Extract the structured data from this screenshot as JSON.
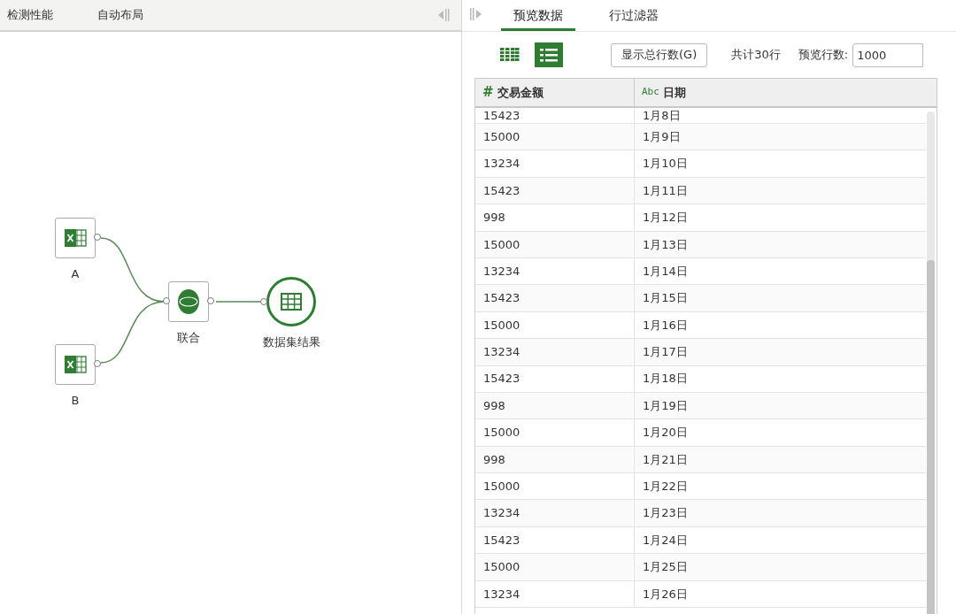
{
  "left_toolbar": {
    "items": [
      "检测性能",
      "自动布局"
    ]
  },
  "canvas": {
    "nodes": [
      {
        "kind": "excel",
        "label": "A"
      },
      {
        "kind": "excel",
        "label": "B"
      },
      {
        "kind": "union",
        "label": "联合"
      },
      {
        "kind": "output",
        "label": "数据集结果"
      }
    ]
  },
  "tabs": [
    {
      "label": "预览数据",
      "selected": true
    },
    {
      "label": "行过滤器",
      "selected": false
    }
  ],
  "view_modes": [
    {
      "kind": "grid",
      "selected": false
    },
    {
      "kind": "list",
      "selected": true
    }
  ],
  "show_total_button": "显示总行数(G)",
  "total_text": "共计30行",
  "preview_rows": {
    "label": "预览行数:",
    "value": "1000"
  },
  "table": {
    "columns": [
      {
        "type": "#",
        "name": "交易金额"
      },
      {
        "type": "Abc",
        "name": "日期"
      }
    ],
    "rows": [
      [
        "15423",
        "1月8日"
      ],
      [
        "15000",
        "1月9日"
      ],
      [
        "13234",
        "1月10日"
      ],
      [
        "15423",
        "1月11日"
      ],
      [
        "998",
        "1月12日"
      ],
      [
        "15000",
        "1月13日"
      ],
      [
        "13234",
        "1月14日"
      ],
      [
        "15423",
        "1月15日"
      ],
      [
        "15000",
        "1月16日"
      ],
      [
        "13234",
        "1月17日"
      ],
      [
        "15423",
        "1月18日"
      ],
      [
        "998",
        "1月19日"
      ],
      [
        "15000",
        "1月20日"
      ],
      [
        "998",
        "1月21日"
      ],
      [
        "15000",
        "1月22日"
      ],
      [
        "13234",
        "1月23日"
      ],
      [
        "15423",
        "1月24日"
      ],
      [
        "15000",
        "1月25日"
      ],
      [
        "13234",
        "1月26日"
      ]
    ]
  }
}
